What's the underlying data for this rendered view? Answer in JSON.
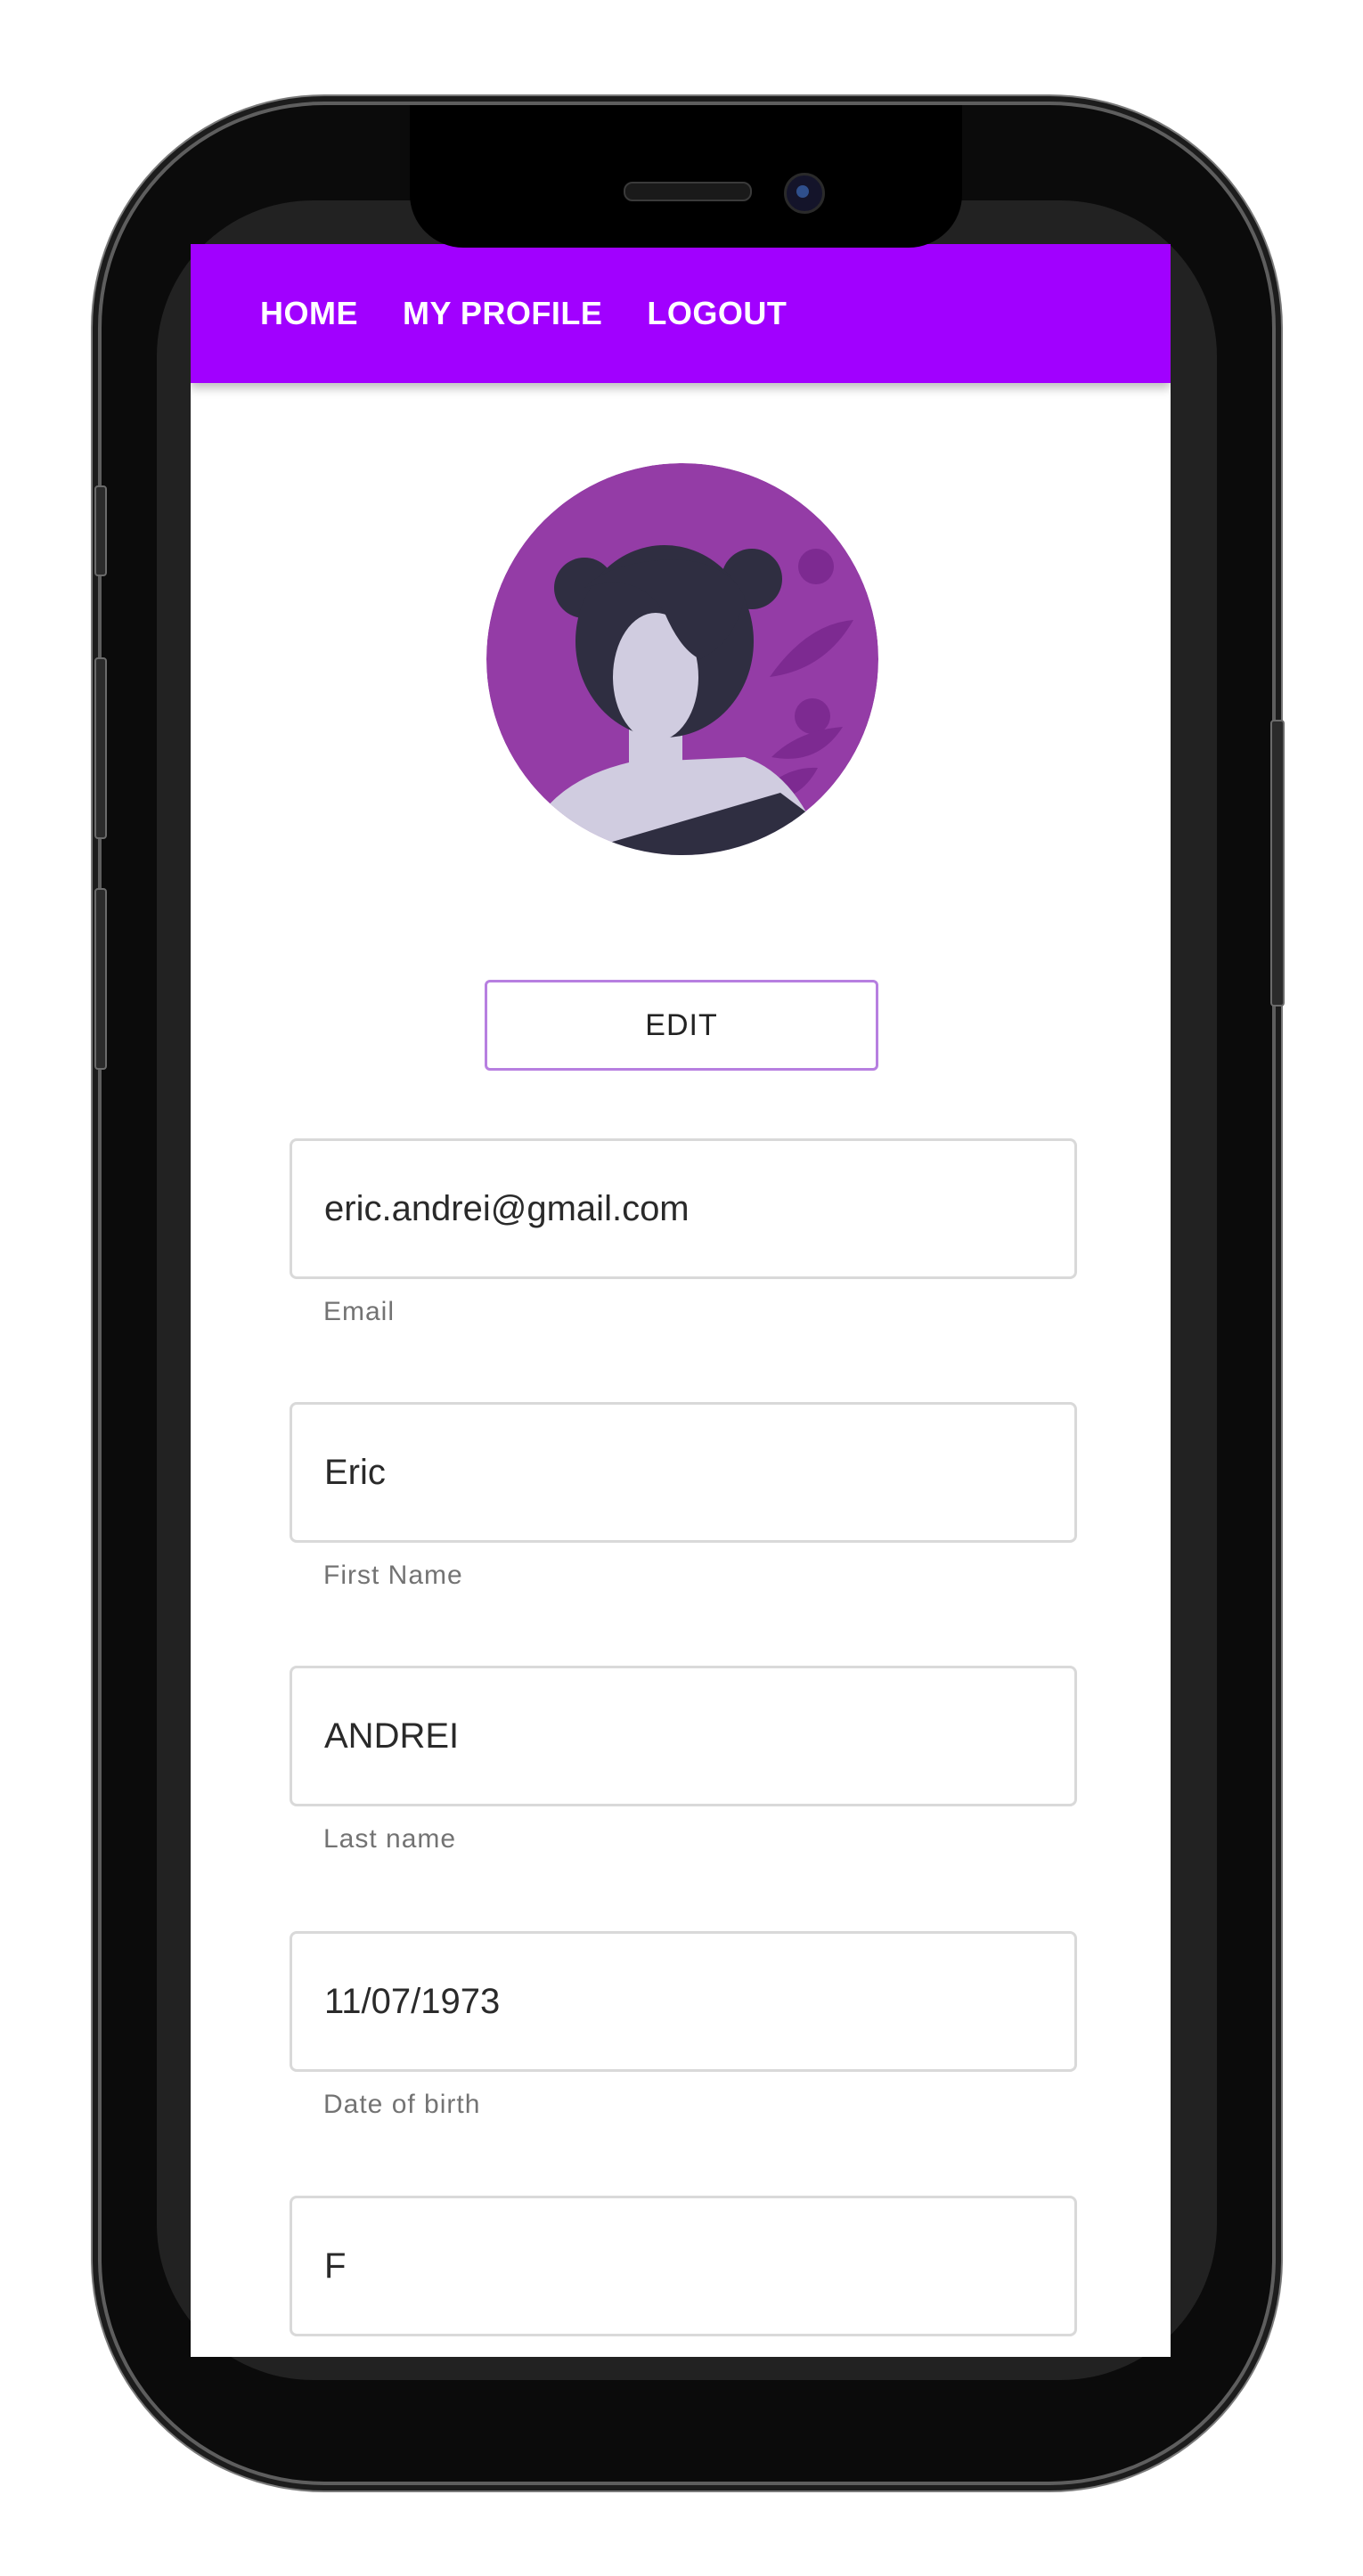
{
  "nav": {
    "home": "HOME",
    "profile": "MY PROFILE",
    "logout": "LOGOUT"
  },
  "profile": {
    "edit_label": "EDIT"
  },
  "fields": {
    "email": {
      "value": "eric.andrei@gmail.com",
      "label": "Email"
    },
    "first_name": {
      "value": "Eric",
      "label": "First Name"
    },
    "last_name": {
      "value": "ANDREI",
      "label": "Last name"
    },
    "dob": {
      "value": "11/07/1973",
      "label": "Date of birth"
    },
    "gender": {
      "value": "F",
      "label": ""
    }
  },
  "colors": {
    "accent": "#a100ff",
    "avatar_bg": "#943ca6",
    "edit_border": "#b77fe0"
  }
}
